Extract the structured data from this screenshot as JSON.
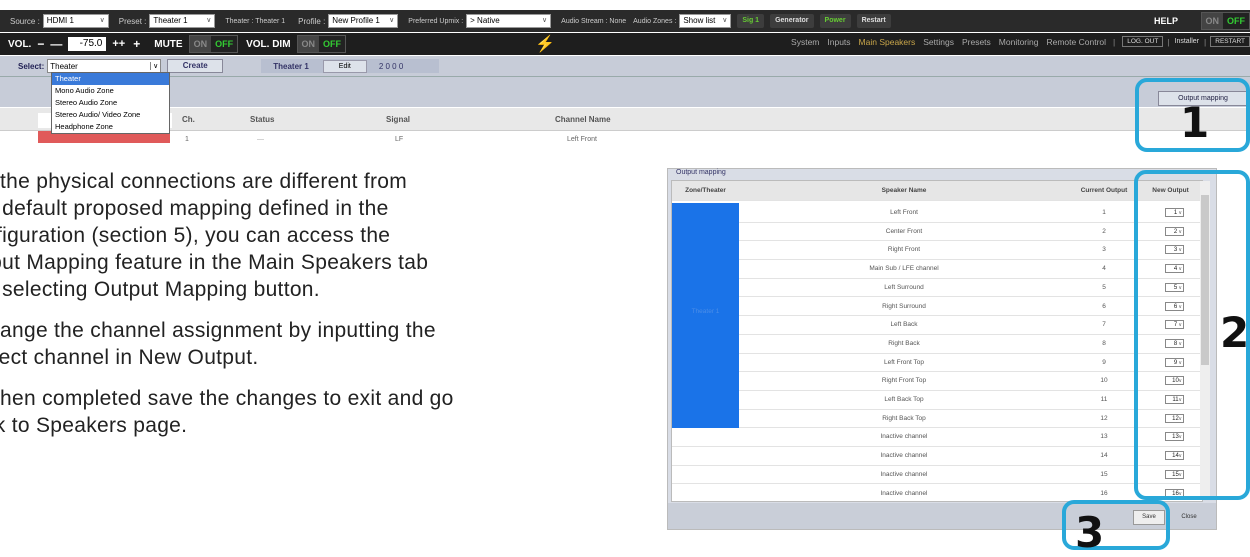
{
  "topbar": {
    "source_label": "Source :",
    "source_value": "HDMI 1",
    "preset_label": "Preset :",
    "preset_value": "Theater 1",
    "theater_label": "Theater : Theater 1",
    "profile_label": "Profile :",
    "profile_value": "New Profile 1",
    "upmix_label": "Preferred Upmix :",
    "upmix_value": "> Native",
    "audio_stream": "Audio Stream : None",
    "audio_zones_label": "Audio Zones :",
    "audio_zones_value": "Show list",
    "sig_button": "Sig 1",
    "generator_button": "Generator",
    "power_button": "Power",
    "restart_button": "Restart",
    "help_label": "HELP",
    "help_on": "ON",
    "help_off": "OFF"
  },
  "volume": {
    "label": "VOL.",
    "minus": "−",
    "minus_big": "—",
    "value": "-75.0",
    "plus_big": "++",
    "plus": "+",
    "mute_label": "MUTE",
    "mute_on": "ON",
    "mute_off": "OFF",
    "dim_label": "VOL. DIM",
    "dim_on": "ON",
    "dim_off": "OFF",
    "bolt": "⚡"
  },
  "tabs": [
    "System",
    "Inputs",
    "Main Speakers",
    "Settings",
    "Presets",
    "Monitoring",
    "Remote Control"
  ],
  "session": {
    "logout": "LOG. OUT",
    "installer": "Installer",
    "restart": "RESTART"
  },
  "select_bar": {
    "label": "Select:",
    "value": "Theater",
    "create": "Create",
    "zone_name": "Theater 1",
    "edit": "Edit",
    "code": "2 0 0 0"
  },
  "dropdown": [
    "Theater",
    "Mono Audio Zone",
    "Stereo Audio Zone",
    "Stereo Audio/ Video Zone",
    "Headphone Zone"
  ],
  "output_mapping_button": "Output mapping",
  "table": {
    "headers": [
      "Ch.",
      "Status",
      "Signal",
      "Channel Name"
    ],
    "row": [
      "1",
      "—",
      "LF",
      "Left Front"
    ]
  },
  "instructions": {
    "p1": [
      "the physical connections are different from",
      "e default proposed mapping defined in the",
      "nfiguration (section 5), you can access the",
      "tput Mapping feature in the Main Speakers tab",
      "d selecting Output Mapping button."
    ],
    "p2": [
      "ange the channel assignment by inputting the",
      "rrect channel in New Output."
    ],
    "p3": [
      "hen completed save the changes to exit and go",
      "ck to Speakers page."
    ]
  },
  "output_mapping": {
    "title": "Output mapping",
    "headers": [
      "Zone/Theater",
      "Speaker Name",
      "Current Output",
      "New Output"
    ],
    "zone": "Theater 1",
    "rows": [
      {
        "name": "Left Front",
        "cur": "1",
        "new": "1"
      },
      {
        "name": "Center Front",
        "cur": "2",
        "new": "2"
      },
      {
        "name": "Right Front",
        "cur": "3",
        "new": "3"
      },
      {
        "name": "Main Sub / LFE channel",
        "cur": "4",
        "new": "4"
      },
      {
        "name": "Left Surround",
        "cur": "5",
        "new": "5"
      },
      {
        "name": "Right Surround",
        "cur": "6",
        "new": "6"
      },
      {
        "name": "Left Back",
        "cur": "7",
        "new": "7"
      },
      {
        "name": "Right Back",
        "cur": "8",
        "new": "8"
      },
      {
        "name": "Left Front Top",
        "cur": "9",
        "new": "9"
      },
      {
        "name": "Right Front Top",
        "cur": "10",
        "new": "10"
      },
      {
        "name": "Left Back Top",
        "cur": "11",
        "new": "11"
      },
      {
        "name": "Right Back Top",
        "cur": "12",
        "new": "12"
      },
      {
        "name": "Inactive channel",
        "cur": "13",
        "new": "13"
      },
      {
        "name": "Inactive channel",
        "cur": "14",
        "new": "14"
      },
      {
        "name": "Inactive channel",
        "cur": "15",
        "new": "15"
      },
      {
        "name": "Inactive channel",
        "cur": "16",
        "new": "16"
      }
    ],
    "save": "Save",
    "close": "Close"
  },
  "callouts": [
    "1",
    "2",
    "3"
  ],
  "colors": {
    "callout": "#29a8d9",
    "zone_blue": "#1a73e8",
    "active_tab": "#c9a64a",
    "off_green": "#33cc33"
  }
}
